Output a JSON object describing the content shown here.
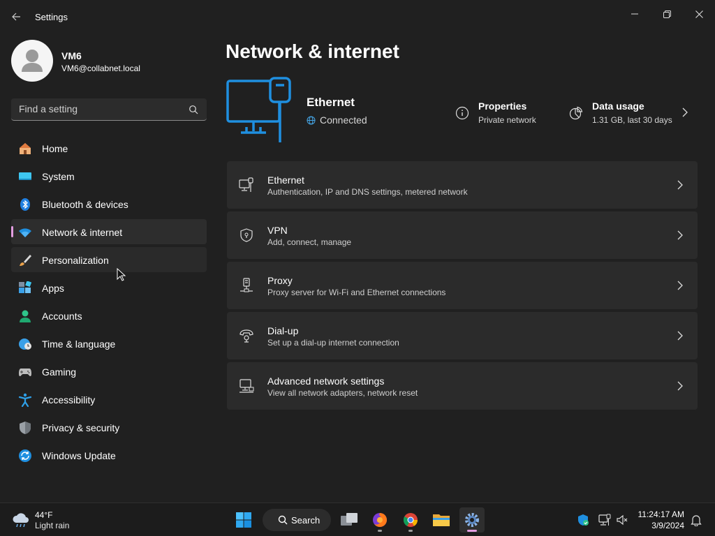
{
  "window": {
    "title": "Settings"
  },
  "profile": {
    "name": "VM6",
    "email": "VM6@collabnet.local"
  },
  "search": {
    "placeholder": "Find a setting"
  },
  "sidebar": {
    "items": [
      {
        "label": "Home",
        "icon": "home-icon"
      },
      {
        "label": "System",
        "icon": "system-icon"
      },
      {
        "label": "Bluetooth & devices",
        "icon": "bluetooth-icon"
      },
      {
        "label": "Network & internet",
        "icon": "wifi-icon",
        "selected": true
      },
      {
        "label": "Personalization",
        "icon": "brush-icon"
      },
      {
        "label": "Apps",
        "icon": "apps-icon"
      },
      {
        "label": "Accounts",
        "icon": "accounts-icon"
      },
      {
        "label": "Time & language",
        "icon": "clock-globe-icon"
      },
      {
        "label": "Gaming",
        "icon": "gamepad-icon"
      },
      {
        "label": "Accessibility",
        "icon": "accessibility-icon"
      },
      {
        "label": "Privacy & security",
        "icon": "shield-icon"
      },
      {
        "label": "Windows Update",
        "icon": "update-icon"
      }
    ]
  },
  "main": {
    "title": "Network & internet",
    "hero": {
      "title": "Ethernet",
      "status": "Connected",
      "properties": {
        "title": "Properties",
        "subtitle": "Private network"
      },
      "data_usage": {
        "title": "Data usage",
        "subtitle": "1.31 GB, last 30 days"
      }
    },
    "cards": [
      {
        "title": "Ethernet",
        "subtitle": "Authentication, IP and DNS settings, metered network",
        "icon": "ethernet-icon"
      },
      {
        "title": "VPN",
        "subtitle": "Add, connect, manage",
        "icon": "vpn-shield-icon"
      },
      {
        "title": "Proxy",
        "subtitle": "Proxy server for Wi-Fi and Ethernet connections",
        "icon": "proxy-icon"
      },
      {
        "title": "Dial-up",
        "subtitle": "Set up a dial-up internet connection",
        "icon": "dialup-icon"
      },
      {
        "title": "Advanced network settings",
        "subtitle": "View all network adapters, network reset",
        "icon": "advanced-network-icon"
      }
    ]
  },
  "taskbar": {
    "weather": {
      "temp": "44°F",
      "desc": "Light rain"
    },
    "search_label": "Search",
    "clock": {
      "time": "11:24:17 AM",
      "date": "3/9/2024"
    }
  },
  "colors": {
    "accent": "#e39de1",
    "blue": "#1f8fe0",
    "background": "#202020",
    "card": "#2b2b2b"
  }
}
